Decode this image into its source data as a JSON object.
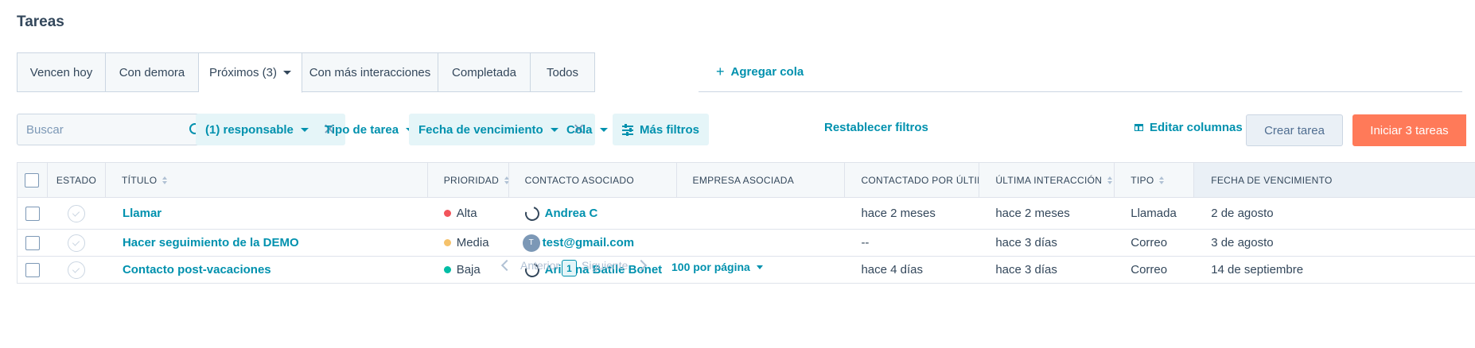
{
  "page": {
    "title": "Tareas"
  },
  "tabs": [
    {
      "label": "Vencen hoy"
    },
    {
      "label": "Con demora"
    },
    {
      "label": "Próximos (3)"
    },
    {
      "label": "Con más interacciones"
    },
    {
      "label": "Completada"
    },
    {
      "label": "Todos"
    }
  ],
  "active_tab": "Próximos (3)",
  "add_queue_label": "Agregar cola",
  "search": {
    "placeholder": "Buscar",
    "value": ""
  },
  "filters": {
    "owner": "(1) responsable",
    "task_type": "Tipo de tarea",
    "due_date": "Fecha de vencimiento",
    "queue": "Cola",
    "more": "Más filtros",
    "reset": "Restablecer filtros"
  },
  "actions": {
    "edit_columns": "Editar columnas",
    "create_task": "Crear tarea",
    "start_tasks": "Iniciar 3 tareas"
  },
  "table": {
    "headers": {
      "status": "ESTADO",
      "title": "TÍTULO",
      "priority": "PRIORIDAD",
      "contact": "CONTACTO ASOCIADO",
      "company": "EMPRESA ASOCIADA",
      "last_contacted": "CONTACTADO POR ÚLTIMA VEZ",
      "last_interaction": "ÚLTIMA INTERACCIÓN",
      "type": "TIPO",
      "due_date": "FECHA DE VENCIMIENTO"
    },
    "rows": [
      {
        "title": "Llamar",
        "priority": "Alta",
        "priority_color": "#f2545b",
        "contact": "Andrea C",
        "contact_avatar": "",
        "company": "",
        "last_contacted": "hace 2 meses",
        "last_interaction": "hace 2 meses",
        "type": "Llamada",
        "due_date": "2 de agosto"
      },
      {
        "title": "Hacer seguimiento de la DEMO",
        "priority": "Media",
        "priority_color": "#f5c26b",
        "contact": "test@gmail.com",
        "contact_avatar": "T",
        "company": "",
        "last_contacted": "--",
        "last_interaction": "hace 3 días",
        "type": "Correo",
        "due_date": "3 de agosto"
      },
      {
        "title": "Contacto post-vacaciones",
        "priority": "Baja",
        "priority_color": "#00bda5",
        "contact": "Ariadna Batlle Bonet",
        "contact_avatar": "",
        "company": "",
        "last_contacted": "hace 4 días",
        "last_interaction": "hace 3 días",
        "type": "Correo",
        "due_date": "14 de septiembre"
      }
    ]
  },
  "pagination": {
    "prev": "Anterior",
    "current": "1",
    "next": "Siguiente",
    "per_page": "100 por página"
  },
  "colors": {
    "accent": "#0091ae",
    "primary_button": "#ff7a59",
    "text": "#33475b"
  }
}
